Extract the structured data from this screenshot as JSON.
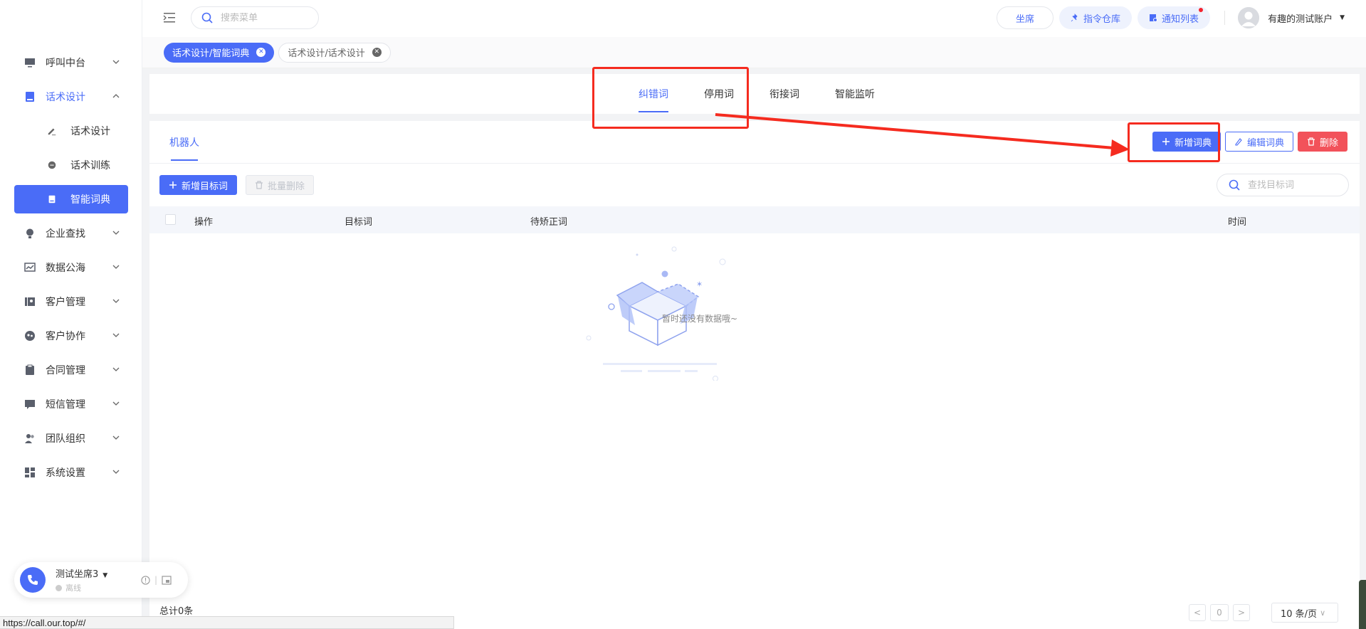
{
  "header": {
    "search_placeholder": "搜索菜单",
    "seat_label": "坐席",
    "command_repo_label": "指令仓库",
    "notice_list_label": "通知列表",
    "user_name": "有趣的测试账户"
  },
  "sidebar": {
    "items": [
      {
        "label": "呼叫中台",
        "icon": "monitor-icon"
      },
      {
        "label": "话术设计",
        "icon": "book-icon",
        "open": true
      },
      {
        "label": "话术设计",
        "icon": "pen-icon",
        "sub": true
      },
      {
        "label": "话术训练",
        "icon": "chat-icon",
        "sub": true
      },
      {
        "label": "智能词典",
        "icon": "dictionary-icon",
        "sub": true,
        "active": true
      },
      {
        "label": "企业查找",
        "icon": "bulb-icon"
      },
      {
        "label": "数据公海",
        "icon": "chart-icon"
      },
      {
        "label": "客户管理",
        "icon": "contacts-icon"
      },
      {
        "label": "客户协作",
        "icon": "team-icon"
      },
      {
        "label": "合同管理",
        "icon": "clipboard-icon"
      },
      {
        "label": "短信管理",
        "icon": "message-icon"
      },
      {
        "label": "团队组织",
        "icon": "group-icon"
      },
      {
        "label": "系统设置",
        "icon": "dashboard-icon"
      }
    ]
  },
  "agent": {
    "name": "测试坐席3",
    "status": "离线"
  },
  "status_url": "https://call.our.top/#/",
  "tags": [
    {
      "label": "话术设计/智能词典",
      "active": true
    },
    {
      "label": "话术设计/话术设计",
      "active": false
    }
  ],
  "main_tabs": [
    "纠错词",
    "停用词",
    "衔接词",
    "智能监听"
  ],
  "sub_tab": "机器人",
  "dict_actions": {
    "add": "新增词典",
    "edit": "编辑词典",
    "delete": "删除"
  },
  "toolbar": {
    "add_target": "新增目标词",
    "batch_delete": "批量删除",
    "search_placeholder": "查找目标词"
  },
  "table": {
    "columns": [
      "操作",
      "目标词",
      "待矫正词",
      "时间"
    ],
    "rows": [],
    "empty_text": "暂时还没有数据哦~"
  },
  "footer": {
    "total": "总计0条",
    "page": "0",
    "page_size": "10 条/页"
  },
  "colors": {
    "primary": "#4a6cf7",
    "danger": "#f2525a",
    "annotation": "#f52b1f"
  }
}
